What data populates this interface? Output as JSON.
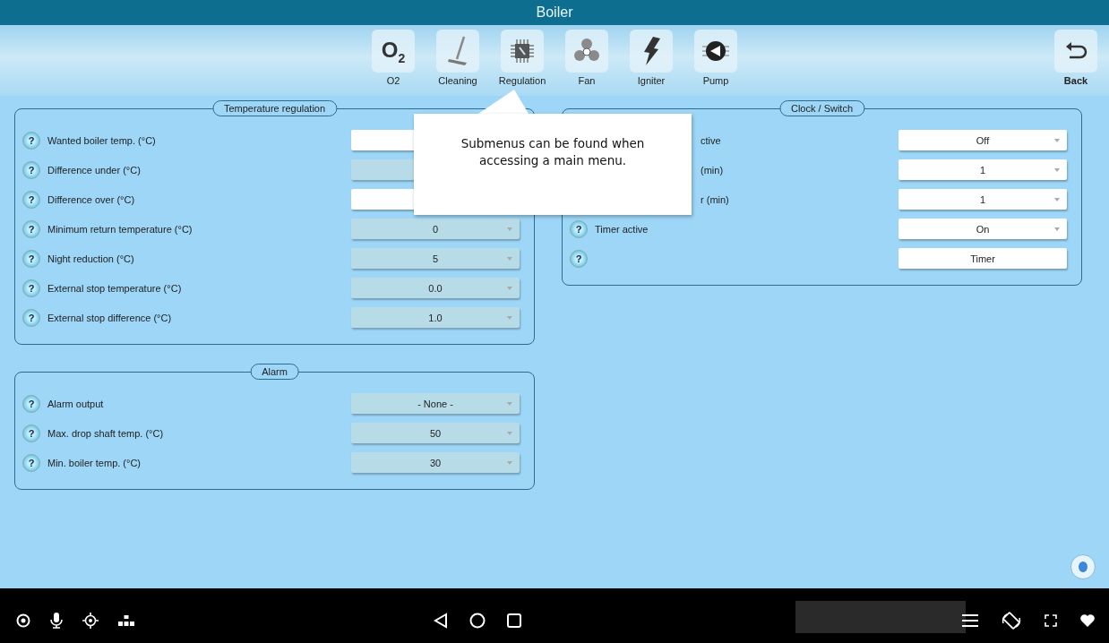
{
  "title": "Boiler",
  "menu": [
    {
      "label": "O2",
      "kind": "o2",
      "icon_text": "O$_{2}$"
    },
    {
      "label": "Cleaning",
      "kind": "broom"
    },
    {
      "label": "Regulation",
      "kind": "chip"
    },
    {
      "label": "Fan",
      "kind": "fan"
    },
    {
      "label": "Igniter",
      "kind": "bolt"
    },
    {
      "label": "Pump",
      "kind": "pump"
    }
  ],
  "back": {
    "label": "Back"
  },
  "left_column": [
    {
      "title": "Temperature regulation",
      "rows": [
        {
          "help": "?",
          "label": "Wanted boiler temp. (°C)",
          "disabled": false
        },
        {
          "help": "?",
          "label": "Difference under (°C)",
          "disabled": true
        },
        {
          "help": "?",
          "label": "Difference over (°C)",
          "disabled": false
        },
        {
          "help": "?",
          "label": "Minimum return temperature (°C)",
          "disabled": true,
          "value": "0",
          "dropdown": true
        },
        {
          "help": "?",
          "label": "Night reduction (°C)",
          "disabled": true,
          "value": "5",
          "dropdown": true
        },
        {
          "help": "?",
          "label": "External stop temperature (°C)",
          "disabled": true,
          "value": "0.0",
          "dropdown": true
        },
        {
          "help": "?",
          "label": "External stop difference (°C)",
          "disabled": true,
          "value": "1.0",
          "dropdown": true
        }
      ]
    },
    {
      "title": "Alarm",
      "rows": [
        {
          "help": "?",
          "label": "Alarm output",
          "disabled": true,
          "value": "- None -",
          "dropdown": true
        },
        {
          "help": "?",
          "label": "Max. drop shaft temp. (°C)",
          "disabled": true,
          "value": "50",
          "dropdown": true
        },
        {
          "help": "?",
          "label": "Min. boiler temp. (°C)",
          "disabled": true,
          "value": "30",
          "dropdown": true
        }
      ]
    }
  ],
  "right_column": [
    {
      "title": "Clock / Switch",
      "rows": [
        {
          "label": "ctive",
          "disabled": false,
          "value": "Off",
          "dropdown": true
        },
        {
          "label": "(min)",
          "disabled": false,
          "value": "1",
          "dropdown": true
        },
        {
          "label": "r (min)",
          "disabled": false,
          "value": "1",
          "dropdown": true
        },
        {
          "help": "?",
          "label": "Timer active",
          "disabled": false,
          "value": "On",
          "dropdown": true
        },
        {
          "help": "?",
          "disabled": false,
          "value": "Timer",
          "dropdown": false
        }
      ]
    }
  ],
  "callout": "Submenus can be found when accessing a main menu."
}
